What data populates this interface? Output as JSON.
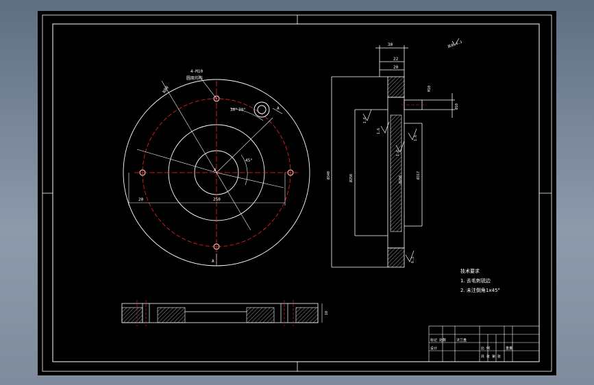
{
  "drawing": {
    "colors": {
      "background": "#000000",
      "line": "#ffffff",
      "centerline": "#ff2020",
      "section_hatch": "#9a9a9a"
    },
    "plan_view": {
      "hole_callout_line1": "4-M10",
      "hole_callout_line2": "圆周均布",
      "radius_label": "R80",
      "angle_label_a": "30°",
      "angle_label_b": "30°",
      "angle_label_c": "45°",
      "dim_bottom_left": "20",
      "dim_center": "250",
      "center_mark": "A",
      "section_marker_top": "A",
      "section_marker_bottom": "A"
    },
    "side_view": {
      "dim_top_width": "30",
      "dim_top_inner": "22",
      "dim_top_second": "20",
      "dim_right_upper": "M10",
      "dim_right_hole": "Ø10",
      "dim_overall_height": "Ø340",
      "dim_inner_bore": "Ø250",
      "dim_inner_bore_2": "Ø260",
      "dim_right_diameter": "Ø317",
      "roughness_1": "1.6",
      "roughness_2": "1.6",
      "roughness_3": "1.6",
      "roughness_4": "1.6",
      "roughness_5": "6.3",
      "roughness_general": "其余 6.3"
    },
    "section_view": {
      "dim_height": "10"
    },
    "tech_requirements": {
      "title": "技术要求",
      "item1": "1. 去毛刺锐边",
      "item2": "2. 未注倒角1x45°"
    },
    "title_block": {
      "name_cell": "标记 处数",
      "drawing_name": "法兰盘",
      "designer_cell": "设计",
      "scale_cell": "比 例",
      "sheet_cell": "共 张 第 张",
      "weight_cell": "重量"
    }
  }
}
